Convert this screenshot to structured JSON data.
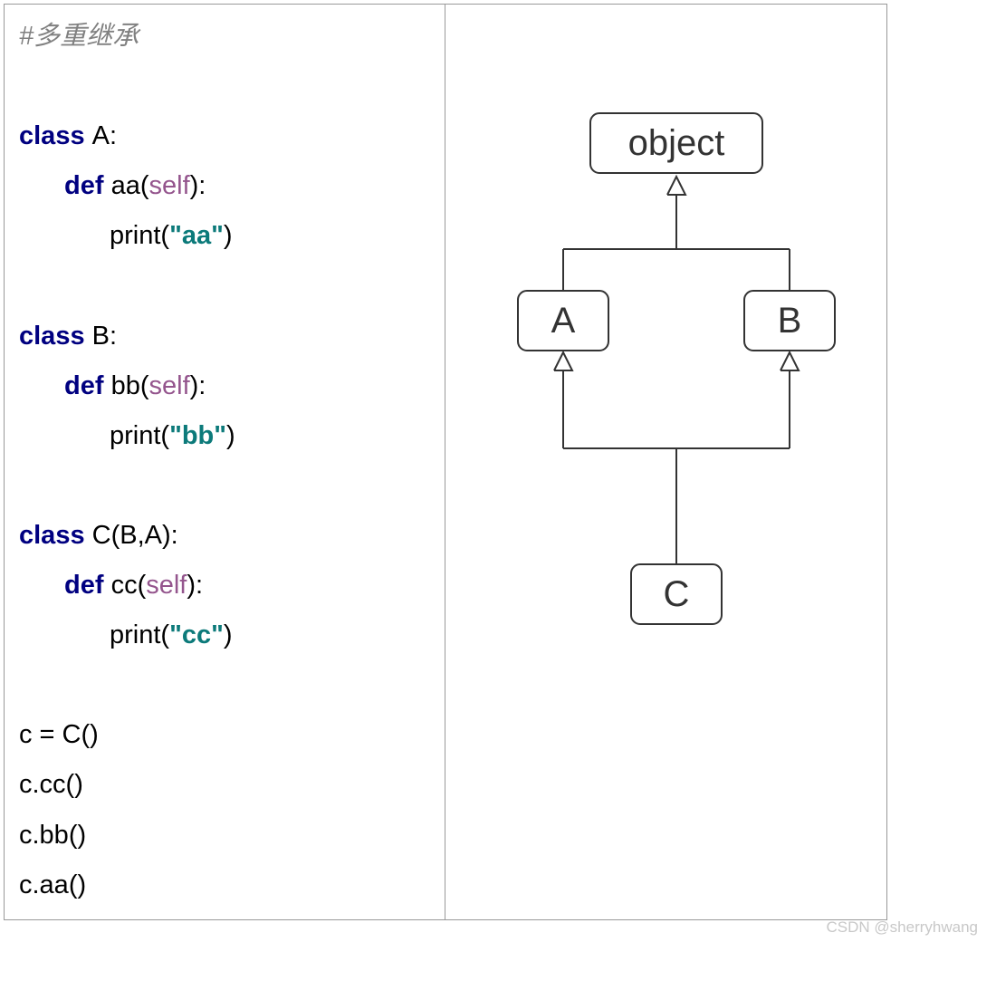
{
  "comment": "#多重继承",
  "code": {
    "classA": {
      "decl": "A:",
      "method": "aa",
      "param": "self",
      "call": "print(",
      "str": "\"aa\"",
      "close": ")"
    },
    "classB": {
      "decl": "B:",
      "method": "bb",
      "param": "self",
      "call": "print(",
      "str": "\"bb\"",
      "close": ")"
    },
    "classC": {
      "decl": "C(B,A):",
      "method": "cc",
      "param": "self",
      "call": "print(",
      "str": "\"cc\"",
      "close": ")"
    },
    "kw_class": "class ",
    "kw_def": "def ",
    "usage": [
      "c = C()",
      "c.cc()",
      "c.bb()",
      "c.aa()"
    ]
  },
  "diagram": {
    "nodes": {
      "object": "object",
      "A": "A",
      "B": "B",
      "C": "C"
    }
  },
  "watermark": "CSDN @sherryhwang"
}
